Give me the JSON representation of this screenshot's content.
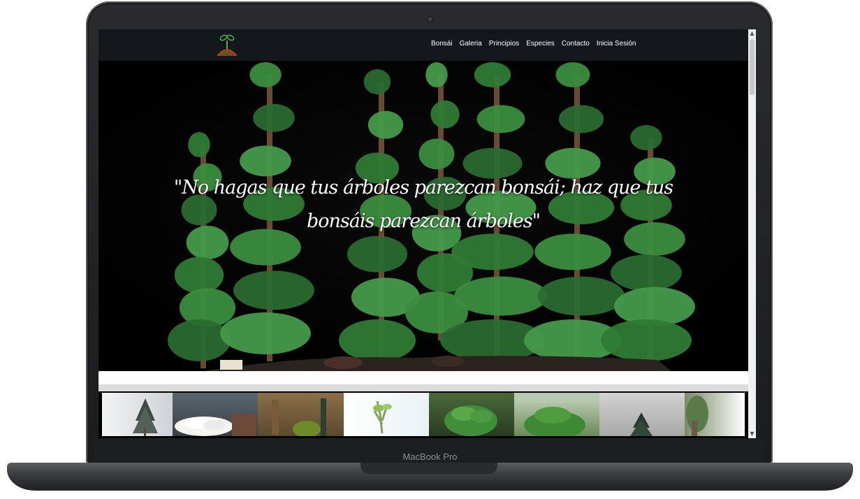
{
  "device": {
    "label": "MacBook Pro"
  },
  "site": {
    "logo_icon": "bonsai-sprout-icon",
    "nav": [
      "Bonsái",
      "Galeria",
      "Principios",
      "Especies",
      "Contacto",
      "Inicia Sesión"
    ]
  },
  "hero": {
    "quote": "\"No hagas que tus árboles parezcan bonsái; haz que tus bonsáis parezcan árboles\""
  },
  "gallery": {
    "count": 8
  },
  "colors": {
    "navbar": "#14181c",
    "hero_bg": "#000000",
    "foliage": "#2f7a35"
  }
}
